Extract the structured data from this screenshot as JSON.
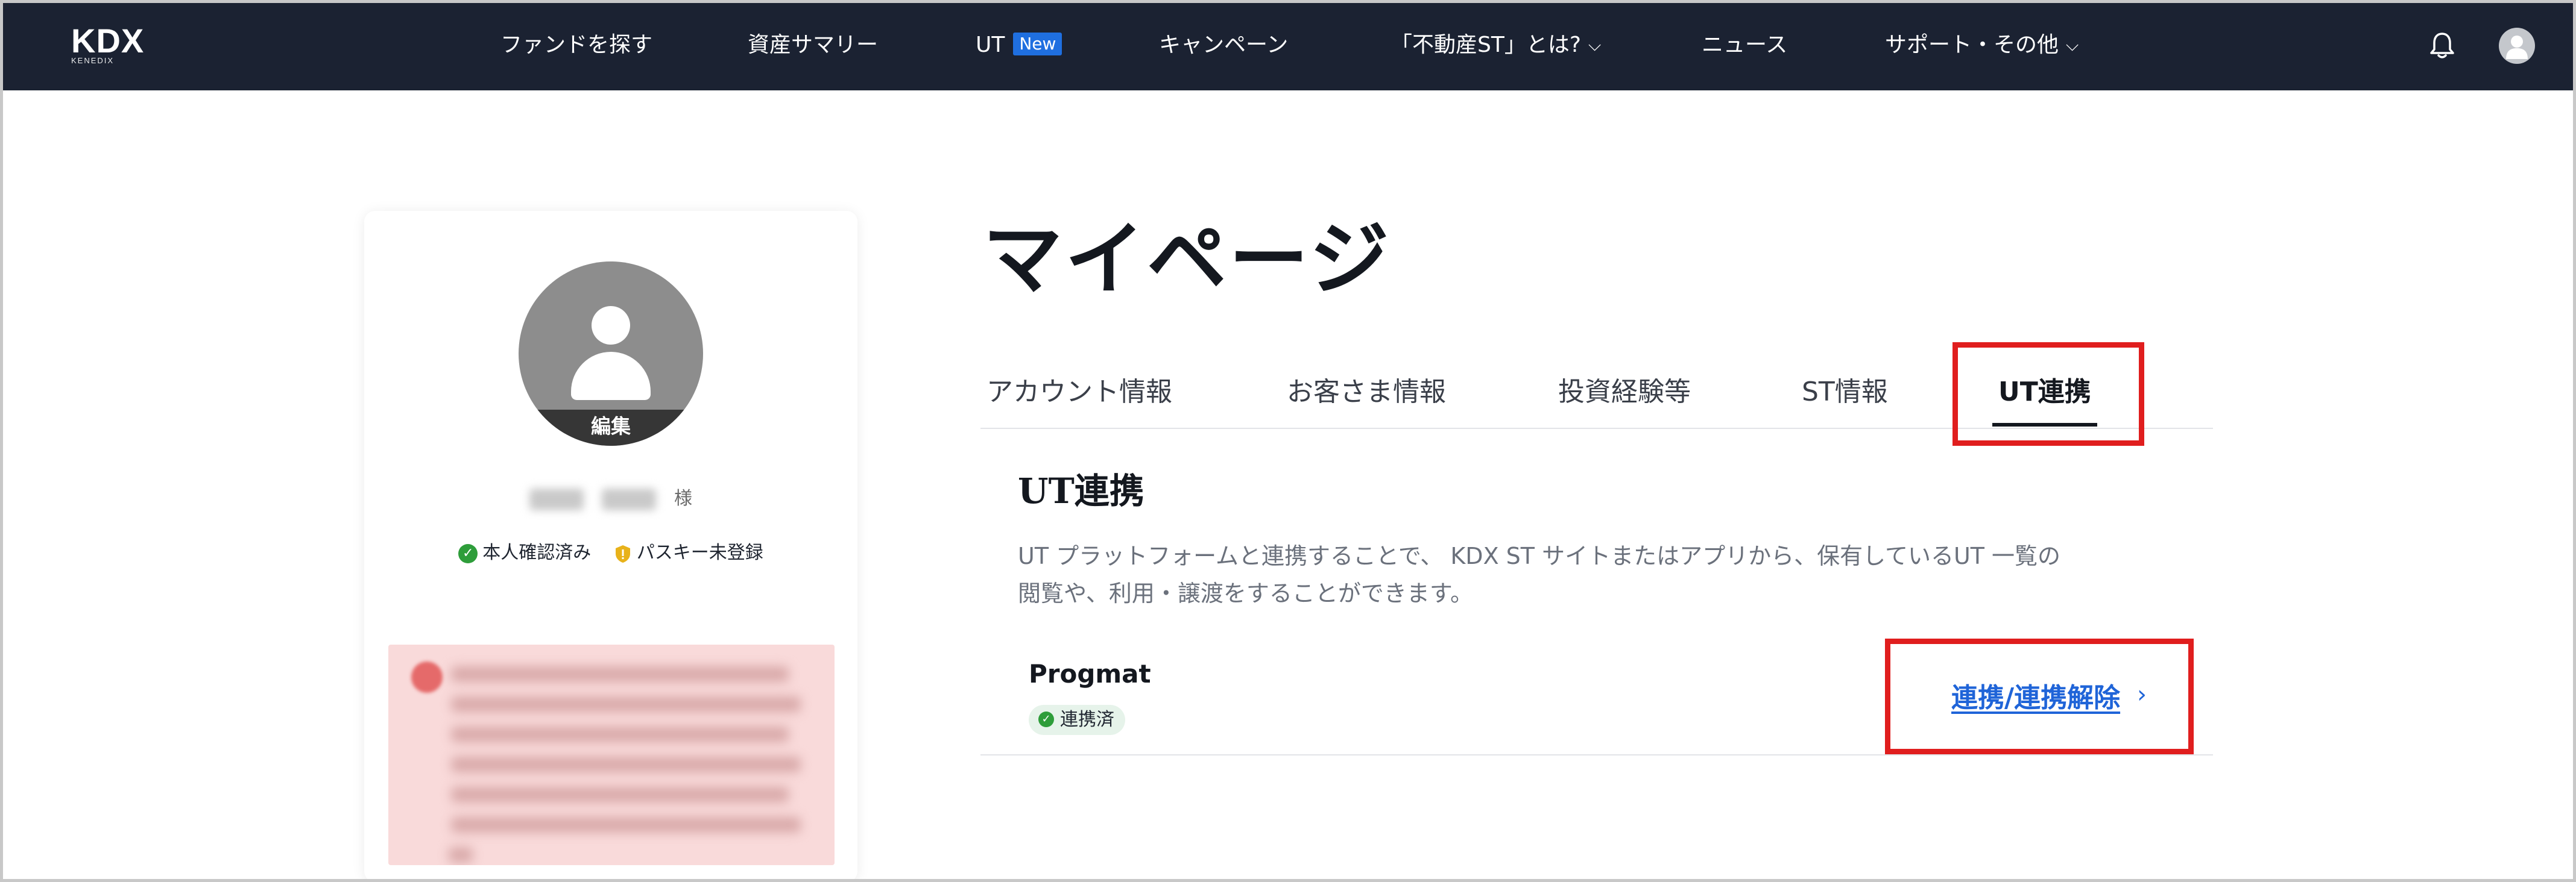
{
  "header": {
    "logo": "KDX",
    "logo_sub": "KENEDIX",
    "nav": [
      {
        "label": "ファンドを探す"
      },
      {
        "label": "資産サマリー"
      },
      {
        "label": "UT",
        "badge": "New"
      },
      {
        "label": "キャンペーン"
      },
      {
        "label": "「不動産ST」とは?",
        "dropdown": true
      },
      {
        "label": "ニュース"
      },
      {
        "label": "サポート・その他",
        "dropdown": true
      }
    ],
    "icons": {
      "notifications": "bell-icon",
      "account": "user-avatar-icon"
    },
    "colors": {
      "background": "#1b2232",
      "new_badge": "#1f6fe0"
    }
  },
  "profile": {
    "edit_label": "編集",
    "name_suffix": "様",
    "statuses": [
      {
        "label": "本人確認済み",
        "icon": "check-circle-icon",
        "color": "#2e9d3a"
      },
      {
        "label": "パスキー未登録",
        "icon": "shield-warning-icon",
        "color": "#e8b21a"
      }
    ]
  },
  "main": {
    "page_title": "マイページ",
    "tabs": [
      {
        "label": "アカウント情報"
      },
      {
        "label": "お客さま情報"
      },
      {
        "label": "投資経験等"
      },
      {
        "label": "ST情報"
      },
      {
        "label": "UT連携",
        "active": true
      }
    ],
    "section": {
      "title": "UT連携",
      "description_line1": "UT プラットフォームと連携することで、 KDX ST サイトまたはアプリから、保有しているUT 一覧の",
      "description_line2": "閲覧や、利用・譲渡をすることができます。",
      "service": {
        "name": "Progmat",
        "status_badge": "連携済",
        "action_label": "連携/連携解除",
        "action_icon": "chevron-right-icon"
      }
    },
    "colors": {
      "link": "#1f64d8",
      "highlight": "#e01e1e",
      "linked_badge_bg": "#e6f3ea"
    }
  }
}
